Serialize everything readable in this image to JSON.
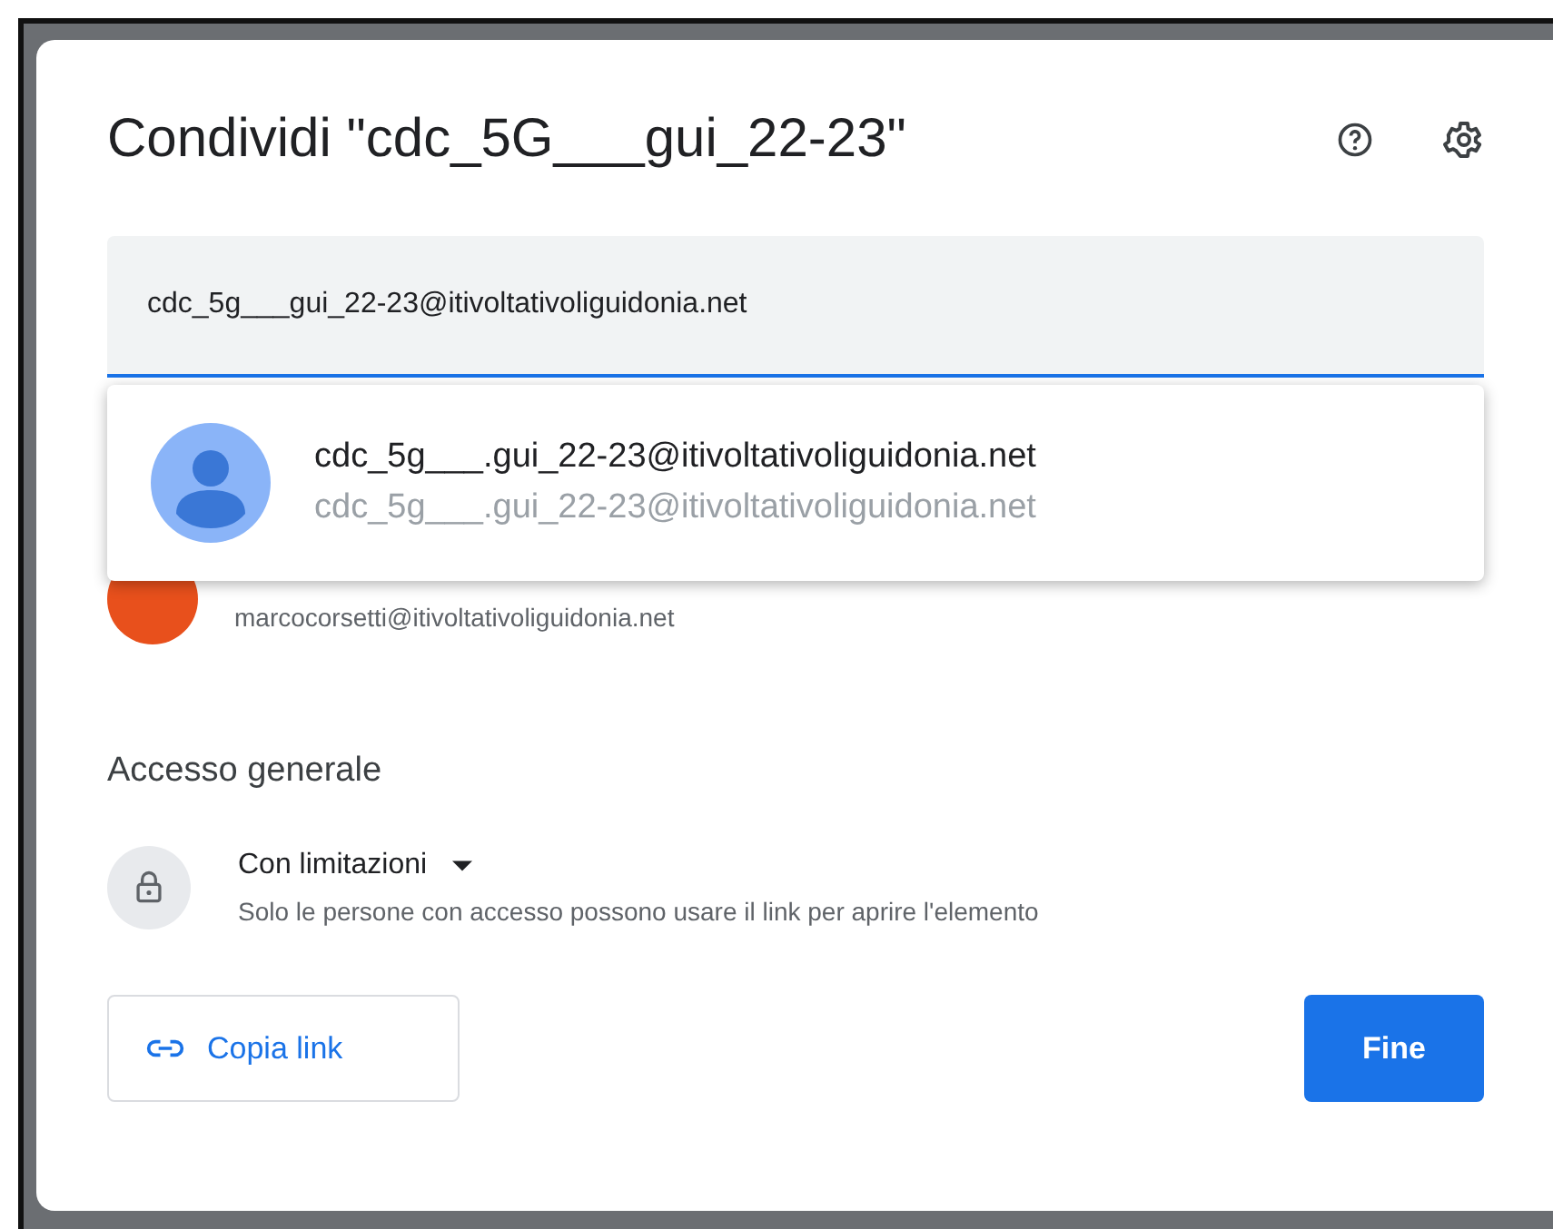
{
  "dialog": {
    "title": "Condividi \"cdc_5G___gui_22-23\""
  },
  "recipient_field": {
    "value": "cdc_5g___gui_22-23@itivoltativoliguidonia.net"
  },
  "suggestion": {
    "name": "cdc_5g___.gui_22-23@itivoltativoliguidonia.net",
    "email": "cdc_5g___.gui_22-23@itivoltativoliguidonia.net"
  },
  "owner": {
    "email": "marcocorsetti@itivoltativoliguidonia.net"
  },
  "general_access": {
    "heading": "Accesso generale",
    "mode": "Con limitazioni",
    "description": "Solo le persone con accesso possono usare il link per aprire l'elemento"
  },
  "buttons": {
    "copy_link": "Copia link",
    "done": "Fine"
  }
}
